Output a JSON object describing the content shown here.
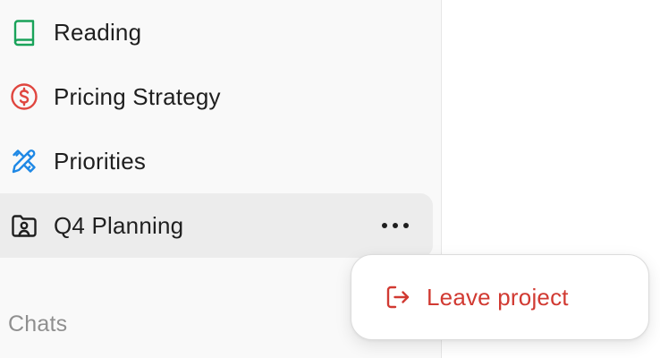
{
  "sidebar": {
    "projects": [
      {
        "label": "Reading",
        "icon": "book-icon",
        "color": "#1aa35a"
      },
      {
        "label": "Pricing Strategy",
        "icon": "dollar-circle-icon",
        "color": "#e0463f"
      },
      {
        "label": "Priorities",
        "icon": "pencil-ruler-icon",
        "color": "#1e88e5"
      },
      {
        "label": "Q4 Planning",
        "icon": "folder-user-icon",
        "color": "#1f1f1f",
        "active": true
      }
    ],
    "chats_section_label": "Chats"
  },
  "context_menu": {
    "leave_project_label": "Leave project",
    "leave_icon": "leave-icon",
    "danger_color": "#d13a32"
  }
}
